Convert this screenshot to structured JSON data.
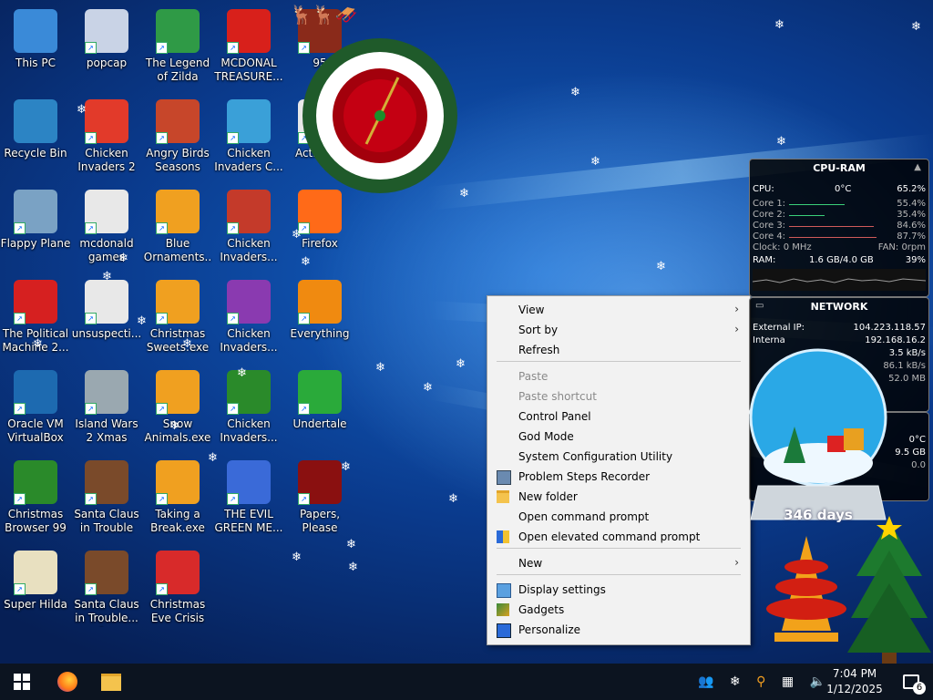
{
  "desktop": {
    "icons": [
      {
        "label": "This PC"
      },
      {
        "label": "popcap"
      },
      {
        "label": "The Legend of Zilda"
      },
      {
        "label": "MCDONAL TREASURE..."
      },
      {
        "label": "95"
      },
      {
        "label": "Recycle Bin"
      },
      {
        "label": "Chicken Invaders 2"
      },
      {
        "label": "Angry Birds Seasons"
      },
      {
        "label": "Chicken Invaders C..."
      },
      {
        "label": "Activator"
      },
      {
        "label": "Flappy Plane"
      },
      {
        "label": "mcdonald games"
      },
      {
        "label": "Blue Ornaments...."
      },
      {
        "label": "Chicken Invaders..."
      },
      {
        "label": "Firefox"
      },
      {
        "label": "The Political Machine 2..."
      },
      {
        "label": "unsuspecti..."
      },
      {
        "label": "Christmas Sweets.exe"
      },
      {
        "label": "Chicken Invaders..."
      },
      {
        "label": "Everything"
      },
      {
        "label": "Oracle VM VirtualBox"
      },
      {
        "label": "Island Wars 2 Xmas"
      },
      {
        "label": "Snow Animals.exe"
      },
      {
        "label": "Chicken Invaders..."
      },
      {
        "label": "Undertale"
      },
      {
        "label": "Christmas Browser 99"
      },
      {
        "label": "Santa Claus in Trouble"
      },
      {
        "label": "Taking a Break.exe"
      },
      {
        "label": "THE EVIL GREEN ME..."
      },
      {
        "label": "Papers, Please"
      },
      {
        "label": "Super Hilda"
      },
      {
        "label": "Santa Claus in Trouble... A..."
      },
      {
        "label": "Christmas Eve Crisis"
      }
    ]
  },
  "context_menu": {
    "items": [
      {
        "label": "View",
        "submenu": true,
        "disabled": false,
        "icon": ""
      },
      {
        "label": "Sort by",
        "submenu": true,
        "disabled": false,
        "icon": ""
      },
      {
        "label": "Refresh",
        "submenu": false,
        "disabled": false,
        "icon": ""
      },
      {
        "label": "Paste",
        "submenu": false,
        "disabled": true,
        "icon": ""
      },
      {
        "label": "Paste shortcut",
        "submenu": false,
        "disabled": true,
        "icon": ""
      },
      {
        "label": "Control Panel",
        "submenu": false,
        "disabled": false,
        "icon": ""
      },
      {
        "label": "God Mode",
        "submenu": false,
        "disabled": false,
        "icon": ""
      },
      {
        "label": "System Configuration Utility",
        "submenu": false,
        "disabled": false,
        "icon": ""
      },
      {
        "label": "Problem Steps Recorder",
        "submenu": false,
        "disabled": false,
        "icon": "recorder-icon"
      },
      {
        "label": "New folder",
        "submenu": false,
        "disabled": false,
        "icon": "folder-icon"
      },
      {
        "label": "Open command prompt",
        "submenu": false,
        "disabled": false,
        "icon": ""
      },
      {
        "label": "Open elevated command prompt",
        "submenu": false,
        "disabled": false,
        "icon": "shield-icon"
      },
      {
        "label": "New",
        "submenu": true,
        "disabled": false,
        "icon": ""
      },
      {
        "label": "Display settings",
        "submenu": false,
        "disabled": false,
        "icon": "display-icon"
      },
      {
        "label": "Gadgets",
        "submenu": false,
        "disabled": false,
        "icon": "gadgets-icon"
      },
      {
        "label": "Personalize",
        "submenu": false,
        "disabled": false,
        "icon": "personalize-icon"
      }
    ]
  },
  "cpu_ram": {
    "title": "CPU-RAM",
    "cpu_label": "CPU:",
    "cpu_temp": "0°C",
    "cpu_pct": "65.2%",
    "cores": [
      {
        "label": "Core 1:",
        "pct": "55.4%",
        "level": 0.554
      },
      {
        "label": "Core 2:",
        "pct": "35.4%",
        "level": 0.354
      },
      {
        "label": "Core 3:",
        "pct": "84.6%",
        "level": 0.846
      },
      {
        "label": "Core 4:",
        "pct": "87.7%",
        "level": 0.877
      }
    ],
    "clock": "Clock: 0 MHz",
    "fan": "FAN: 0rpm",
    "ram_label": "RAM:",
    "ram_value": "1.6 GB/4.0 GB",
    "ram_pct": "39%"
  },
  "network": {
    "title": "NETWORK",
    "external_ip_label": "External IP:",
    "external_ip": "104.223.118.57",
    "internal_ip_label": "Interna",
    "internal_ip": "192.168.16.2",
    "speed1": "3.5 kB/s",
    "speed2": "86.1 kB/s",
    "speed3": "52.0 MB"
  },
  "side_gadget": {
    "temp": "0°C",
    "size": "9.5 GB",
    "val": "0.0"
  },
  "snow_globe": {
    "days": "346 days"
  },
  "taskbar": {
    "time": "7:04 PM",
    "date": "1/12/2025",
    "notification_count": "6"
  },
  "colors": {
    "accent": "#0a3a8c",
    "menu_bg": "#f2f2f2",
    "taskbar": "#0c1420"
  }
}
